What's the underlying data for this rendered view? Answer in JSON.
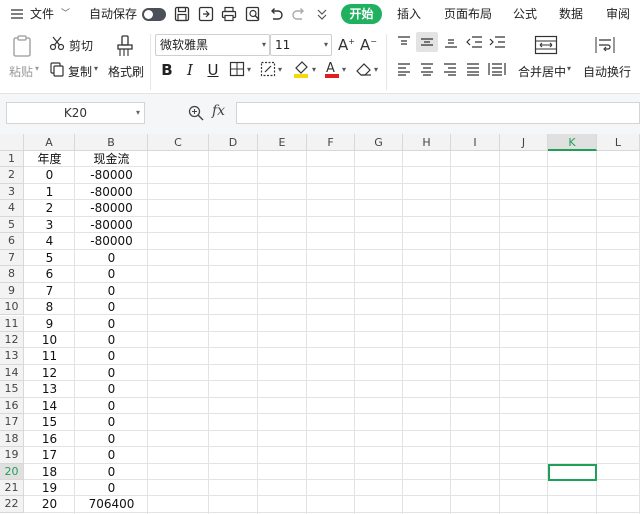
{
  "menubar": {
    "menu_label": "文件",
    "autosave_label": "自动保存",
    "tabs": [
      "开始",
      "插入",
      "页面布局",
      "公式",
      "数据",
      "审阅"
    ]
  },
  "ribbon": {
    "paste": "粘贴",
    "cut": "剪切",
    "copy": "复制",
    "format_painter": "格式刷",
    "font_name": "微软雅黑",
    "font_size": "11",
    "merge_center": "合并居中",
    "wrap_text": "自动换行"
  },
  "formula_bar": {
    "name_box": "K20",
    "fx_label": "fx",
    "formula": ""
  },
  "sheet": {
    "columns": [
      "A",
      "B",
      "C",
      "D",
      "E",
      "F",
      "G",
      "H",
      "I",
      "J",
      "K",
      "L"
    ],
    "selected_column": "K",
    "selected_row": "20",
    "rows": [
      {
        "n": "1",
        "a": "年度",
        "b": "现金流"
      },
      {
        "n": "2",
        "a": "0",
        "b": "-80000"
      },
      {
        "n": "3",
        "a": "1",
        "b": "-80000"
      },
      {
        "n": "4",
        "a": "2",
        "b": "-80000"
      },
      {
        "n": "5",
        "a": "3",
        "b": "-80000"
      },
      {
        "n": "6",
        "a": "4",
        "b": "-80000"
      },
      {
        "n": "7",
        "a": "5",
        "b": "0"
      },
      {
        "n": "8",
        "a": "6",
        "b": "0"
      },
      {
        "n": "9",
        "a": "7",
        "b": "0"
      },
      {
        "n": "10",
        "a": "8",
        "b": "0"
      },
      {
        "n": "11",
        "a": "9",
        "b": "0"
      },
      {
        "n": "12",
        "a": "10",
        "b": "0"
      },
      {
        "n": "13",
        "a": "11",
        "b": "0"
      },
      {
        "n": "14",
        "a": "12",
        "b": "0"
      },
      {
        "n": "15",
        "a": "13",
        "b": "0"
      },
      {
        "n": "16",
        "a": "14",
        "b": "0"
      },
      {
        "n": "17",
        "a": "15",
        "b": "0"
      },
      {
        "n": "18",
        "a": "16",
        "b": "0"
      },
      {
        "n": "19",
        "a": "17",
        "b": "0"
      },
      {
        "n": "20",
        "a": "18",
        "b": "0"
      },
      {
        "n": "21",
        "a": "19",
        "b": "0"
      },
      {
        "n": "22",
        "a": "20",
        "b": "706400"
      }
    ]
  },
  "colors": {
    "accent": "#1fb160",
    "selection": "#1fa058"
  }
}
